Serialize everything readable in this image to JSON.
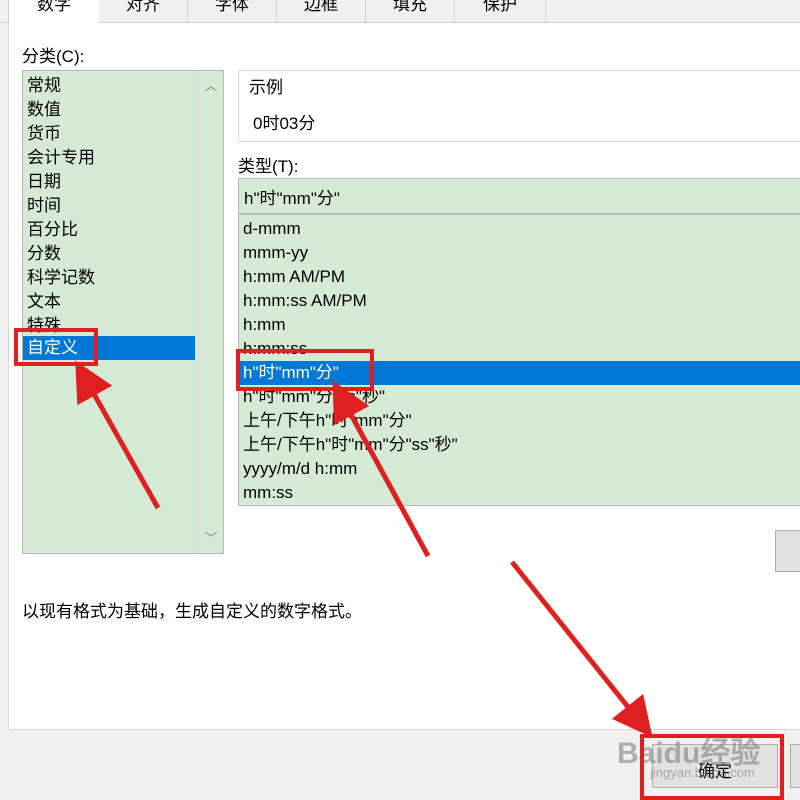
{
  "tabs": [
    "数字",
    "对齐",
    "字体",
    "边框",
    "填充",
    "保护"
  ],
  "category": {
    "label": "分类(C):",
    "items": [
      "常规",
      "数值",
      "货币",
      "会计专用",
      "日期",
      "时间",
      "百分比",
      "分数",
      "科学记数",
      "文本",
      "特殊",
      "自定义"
    ],
    "selected": "自定义"
  },
  "sample": {
    "label": "示例",
    "value": "0时03分"
  },
  "type": {
    "label": "类型(T):",
    "input_value": "h\"时\"mm\"分\"",
    "items": [
      "d-mmm",
      "mmm-yy",
      "h:mm AM/PM",
      "h:mm:ss AM/PM",
      "h:mm",
      "h:mm:ss",
      "h\"时\"mm\"分\"",
      "h\"时\"mm\"分\"ss\"秒\"",
      "上午/下午h\"时\"mm\"分\"",
      "上午/下午h\"时\"mm\"分\"ss\"秒\"",
      "yyyy/m/d h:mm",
      "mm:ss"
    ],
    "selected": "h\"时\"mm\"分\""
  },
  "description": "以现有格式为基础，生成自定义的数字格式。",
  "buttons": {
    "ok": "确定"
  },
  "watermark": {
    "brand": "Baidu经验",
    "url": "jingyan.baidu.com"
  },
  "colors": {
    "list_bg": "#d5ead5",
    "selection": "#0078d7",
    "annotation": "#e02020"
  }
}
